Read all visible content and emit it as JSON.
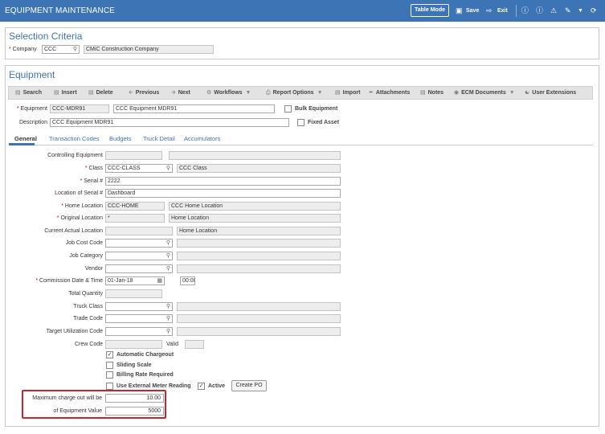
{
  "app": {
    "title": "EQUIPMENT MAINTENANCE",
    "table_mode": "Table Mode",
    "save": "Save",
    "exit": "Exit"
  },
  "selection": {
    "title": "Selection Criteria",
    "company_label": "Company",
    "company_value": "CCC",
    "company_name": "CMiC Construction Company"
  },
  "equipment": {
    "title": "Equipment",
    "toolbar": {
      "search": "Search",
      "insert": "Insert",
      "delete": "Delete",
      "previous": "Previous",
      "next": "Next",
      "workflows": "Workflows",
      "report_options": "Report Options",
      "import": "Import",
      "attachments": "Attachments",
      "notes": "Notes",
      "ecm_documents": "ECM Documents",
      "user_extensions": "User Extensions"
    },
    "equipment_label": "Equipment",
    "equipment_value": "CCC-MDR91",
    "equipment_name": "CCC Equipment MDR91",
    "bulk_equipment": "Bulk Equipment",
    "description_label": "Description",
    "description_value": "CCC Equipment MDR91",
    "fixed_asset": "Fixed Asset"
  },
  "tabs": [
    "General",
    "Transaction Codes",
    "Budgets",
    "Truck Detail",
    "Accumulators"
  ],
  "general": {
    "controlling_equipment": "Controlling Equipment",
    "class_label": "Class",
    "class_value": "CCC-CLASS",
    "class_name": "CCC Class",
    "serial_label": "Serial #",
    "serial_value": "2222",
    "location_serial_label": "Location of Serial #",
    "location_serial_value": "Dashboard",
    "home_location_label": "Home Location",
    "home_location_value": "CCC-HOME",
    "home_location_name": "CCC Home Location",
    "original_location_label": "Original Location",
    "original_location_value": "*",
    "original_location_name": "Home Location",
    "current_actual_location_label": "Current Actual Location",
    "current_actual_location_name": "Home Location",
    "job_cost_code": "Job Cost Code",
    "job_category": "Job Category",
    "vendor": "Vendor",
    "commission_label": "Commission Date & Time",
    "commission_date": "01-Jan-18",
    "commission_time": "00:00",
    "total_quantity": "Total Quantity",
    "truck_class": "Truck Class",
    "trade_code": "Trade Code",
    "target_utilization_code": "Target Utilization Code",
    "crew_code": "Crew Code",
    "valid": "Valid",
    "automatic_chargeout": "Automatic Chargeout",
    "sliding_scale": "Sliding Scale",
    "billing_rate_required": "Billing Rate Required",
    "use_external_meter": "Use External Meter Reading",
    "active": "Active",
    "create_po": "Create PO",
    "max_charge_label": "Maximum charge out will be",
    "max_charge_value": "10.00",
    "equip_value_label": "of Equipment Value",
    "equip_value_value": "5000"
  },
  "colors": {
    "brand": "#3d74b5",
    "highlight_box": "#c0282d"
  }
}
